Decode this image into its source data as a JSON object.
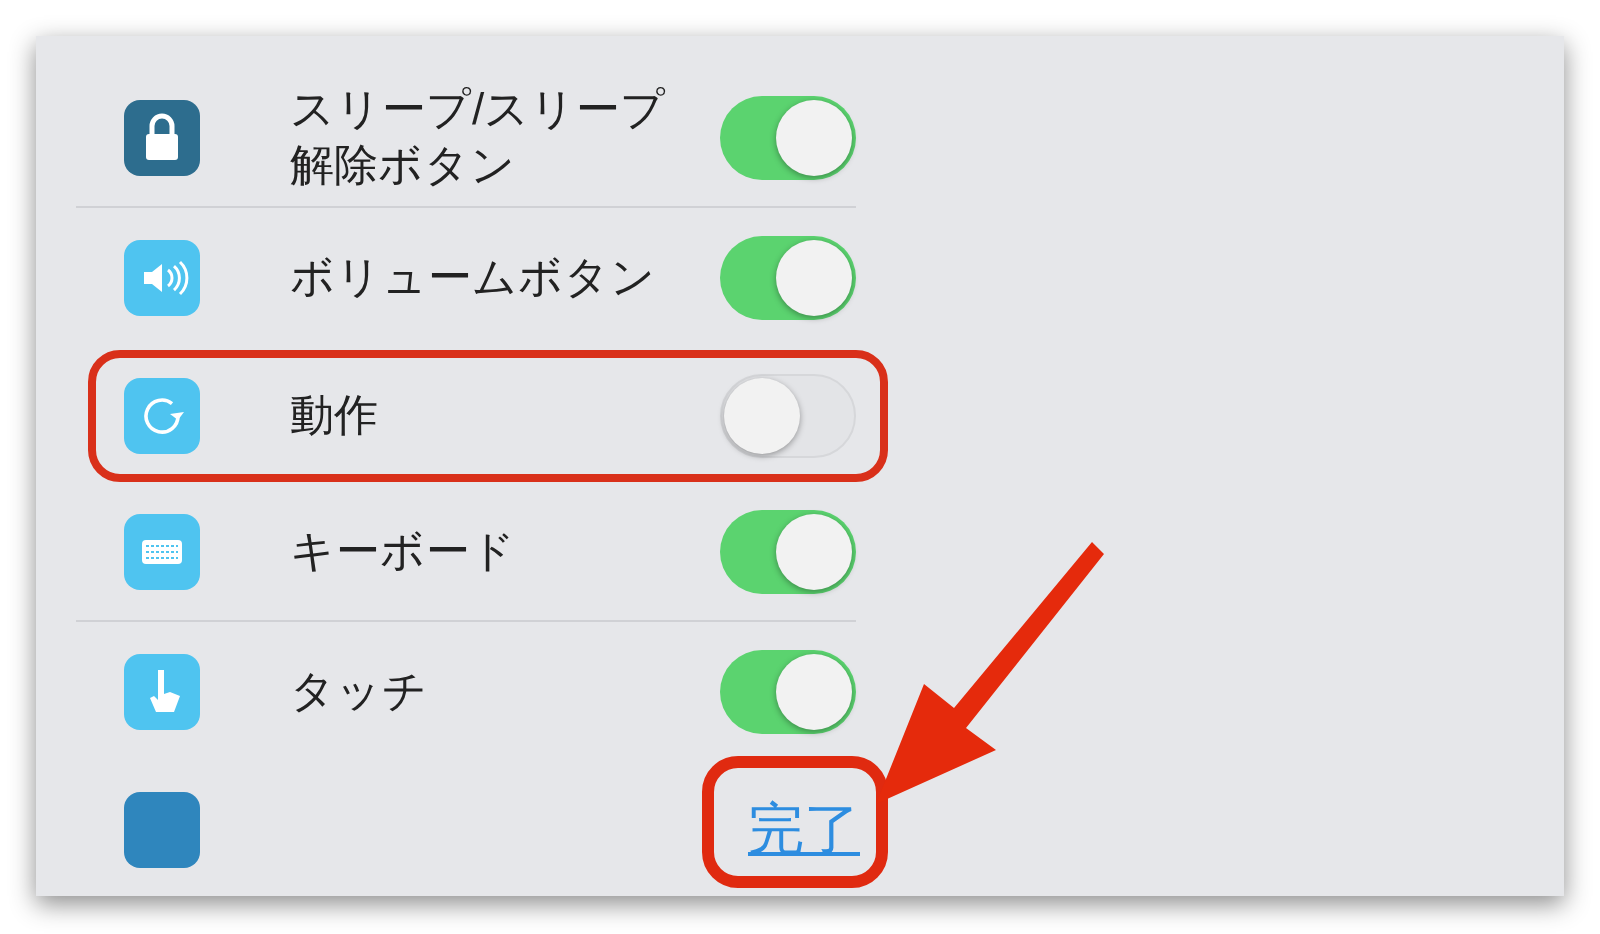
{
  "settings": [
    {
      "kind": "toggle",
      "label": "スリープ/スリープ解除ボタン",
      "on": true,
      "highlighted": false
    },
    {
      "kind": "toggle",
      "label": "ボリュームボタン",
      "on": true,
      "highlighted": false
    },
    {
      "kind": "toggle",
      "label": "動作",
      "on": false,
      "highlighted": true
    },
    {
      "kind": "toggle",
      "label": "キーボード",
      "on": true,
      "highlighted": false
    },
    {
      "kind": "toggle",
      "label": "タッチ",
      "on": true,
      "highlighted": false
    },
    {
      "kind": "button",
      "label": "完了",
      "highlighted": true
    }
  ],
  "annotation_arrow": true
}
